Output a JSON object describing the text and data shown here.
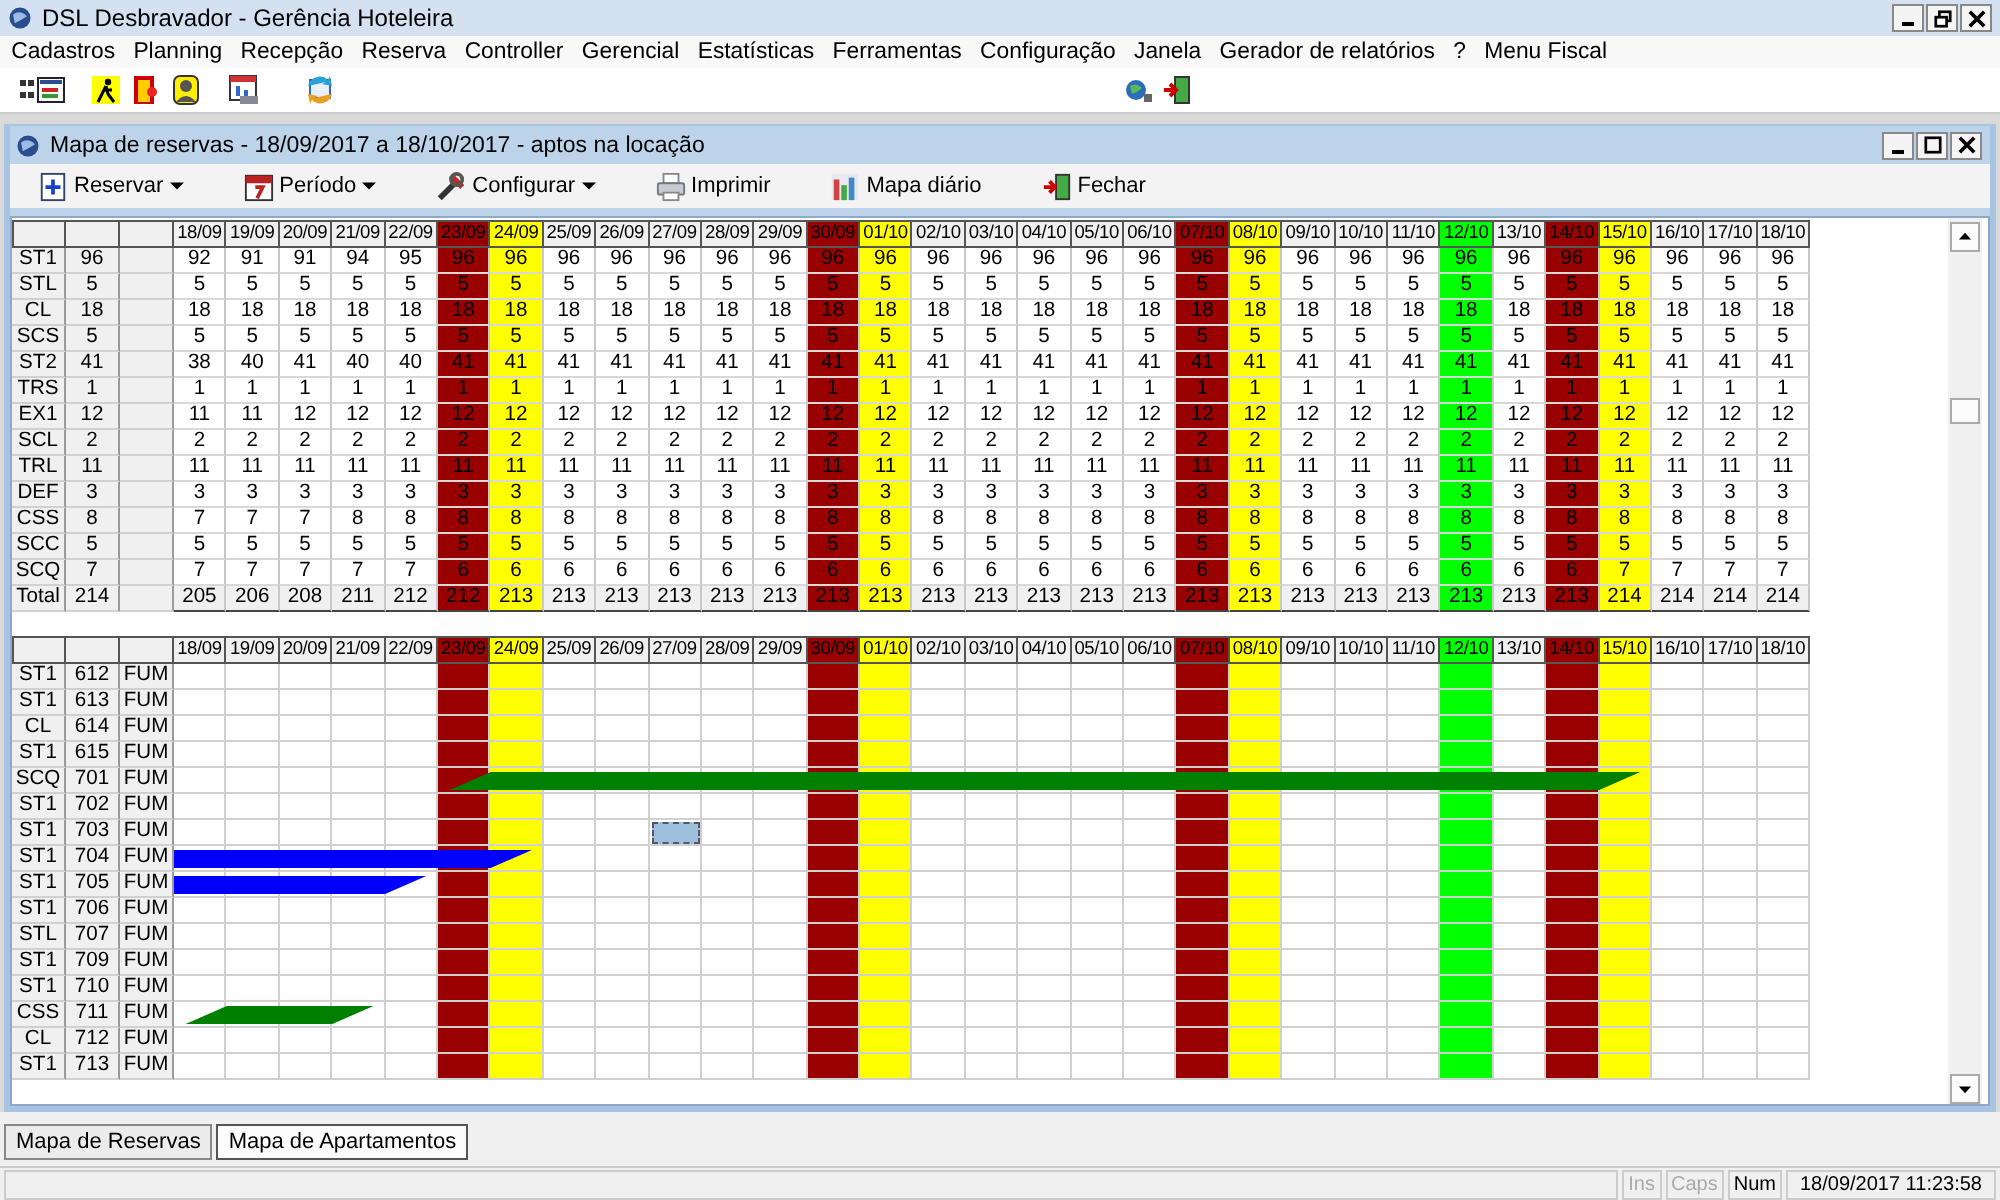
{
  "window": {
    "title": "DSL Desbravador - Gerência Hoteleira"
  },
  "menu": [
    "Cadastros",
    "Planning",
    "Recepção",
    "Reserva",
    "Controller",
    "Gerencial",
    "Estatísticas",
    "Ferramentas",
    "Configuração",
    "Janela",
    "Gerador de relatórios",
    "?",
    "Menu Fiscal"
  ],
  "child_window": {
    "title": "Mapa de reservas - 18/09/2017 a 18/10/2017 - aptos na locação"
  },
  "toolbar": [
    {
      "label": "Reservar",
      "kind": "new",
      "dropdown": true
    },
    {
      "label": "Período",
      "kind": "calendar",
      "dropdown": true
    },
    {
      "label": "Configurar",
      "kind": "tools",
      "dropdown": true
    },
    {
      "label": "Imprimir",
      "kind": "print",
      "dropdown": false
    },
    {
      "label": "Mapa diário",
      "kind": "chart",
      "dropdown": false
    },
    {
      "label": "Fechar",
      "kind": "exit",
      "dropdown": false
    }
  ],
  "availability": {
    "dates": [
      {
        "label": "18/09",
        "kind": "weekday"
      },
      {
        "label": "19/09",
        "kind": "weekday"
      },
      {
        "label": "20/09",
        "kind": "weekday"
      },
      {
        "label": "21/09",
        "kind": "weekday"
      },
      {
        "label": "22/09",
        "kind": "weekday"
      },
      {
        "label": "23/09",
        "kind": "saturday"
      },
      {
        "label": "24/09",
        "kind": "sunday"
      },
      {
        "label": "25/09",
        "kind": "weekday"
      },
      {
        "label": "26/09",
        "kind": "weekday"
      },
      {
        "label": "27/09",
        "kind": "weekday"
      },
      {
        "label": "28/09",
        "kind": "weekday"
      },
      {
        "label": "29/09",
        "kind": "weekday"
      },
      {
        "label": "30/09",
        "kind": "saturday"
      },
      {
        "label": "01/10",
        "kind": "sunday"
      },
      {
        "label": "02/10",
        "kind": "weekday"
      },
      {
        "label": "03/10",
        "kind": "weekday"
      },
      {
        "label": "04/10",
        "kind": "weekday"
      },
      {
        "label": "05/10",
        "kind": "weekday"
      },
      {
        "label": "06/10",
        "kind": "weekday"
      },
      {
        "label": "07/10",
        "kind": "saturday"
      },
      {
        "label": "08/10",
        "kind": "sunday"
      },
      {
        "label": "09/10",
        "kind": "weekday"
      },
      {
        "label": "10/10",
        "kind": "weekday"
      },
      {
        "label": "11/10",
        "kind": "weekday"
      },
      {
        "label": "12/10",
        "kind": "holiday"
      },
      {
        "label": "13/10",
        "kind": "weekday"
      },
      {
        "label": "14/10",
        "kind": "saturday"
      },
      {
        "label": "15/10",
        "kind": "sunday"
      },
      {
        "label": "16/10",
        "kind": "weekday"
      },
      {
        "label": "17/10",
        "kind": "weekday"
      },
      {
        "label": "18/10",
        "kind": "weekday"
      }
    ],
    "rows": [
      {
        "type": "ST1",
        "total": "96",
        "kind": "room_type",
        "values": [
          "92",
          "91",
          "91",
          "94",
          "95",
          "96",
          "96",
          "96",
          "96",
          "96",
          "96",
          "96",
          "96",
          "96",
          "96",
          "96",
          "96",
          "96",
          "96",
          "96",
          "96",
          "96",
          "96",
          "96",
          "96",
          "96",
          "96",
          "96",
          "96",
          "96",
          "96"
        ]
      },
      {
        "type": "STL",
        "total": "5",
        "kind": "room_type",
        "values": [
          "5",
          "5",
          "5",
          "5",
          "5",
          "5",
          "5",
          "5",
          "5",
          "5",
          "5",
          "5",
          "5",
          "5",
          "5",
          "5",
          "5",
          "5",
          "5",
          "5",
          "5",
          "5",
          "5",
          "5",
          "5",
          "5",
          "5",
          "5",
          "5",
          "5",
          "5"
        ]
      },
      {
        "type": "CL",
        "total": "18",
        "kind": "room_type",
        "values": [
          "18",
          "18",
          "18",
          "18",
          "18",
          "18",
          "18",
          "18",
          "18",
          "18",
          "18",
          "18",
          "18",
          "18",
          "18",
          "18",
          "18",
          "18",
          "18",
          "18",
          "18",
          "18",
          "18",
          "18",
          "18",
          "18",
          "18",
          "18",
          "18",
          "18",
          "18"
        ]
      },
      {
        "type": "SCS",
        "total": "5",
        "kind": "room_type",
        "values": [
          "5",
          "5",
          "5",
          "5",
          "5",
          "5",
          "5",
          "5",
          "5",
          "5",
          "5",
          "5",
          "5",
          "5",
          "5",
          "5",
          "5",
          "5",
          "5",
          "5",
          "5",
          "5",
          "5",
          "5",
          "5",
          "5",
          "5",
          "5",
          "5",
          "5",
          "5"
        ]
      },
      {
        "type": "ST2",
        "total": "41",
        "kind": "room_type",
        "values": [
          "38",
          "40",
          "41",
          "40",
          "40",
          "41",
          "41",
          "41",
          "41",
          "41",
          "41",
          "41",
          "41",
          "41",
          "41",
          "41",
          "41",
          "41",
          "41",
          "41",
          "41",
          "41",
          "41",
          "41",
          "41",
          "41",
          "41",
          "41",
          "41",
          "41",
          "41"
        ]
      },
      {
        "type": "TRS",
        "total": "1",
        "kind": "room_type",
        "values": [
          "1",
          "1",
          "1",
          "1",
          "1",
          "1",
          "1",
          "1",
          "1",
          "1",
          "1",
          "1",
          "1",
          "1",
          "1",
          "1",
          "1",
          "1",
          "1",
          "1",
          "1",
          "1",
          "1",
          "1",
          "1",
          "1",
          "1",
          "1",
          "1",
          "1",
          "1"
        ]
      },
      {
        "type": "EX1",
        "total": "12",
        "kind": "room_type",
        "values": [
          "11",
          "11",
          "12",
          "12",
          "12",
          "12",
          "12",
          "12",
          "12",
          "12",
          "12",
          "12",
          "12",
          "12",
          "12",
          "12",
          "12",
          "12",
          "12",
          "12",
          "12",
          "12",
          "12",
          "12",
          "12",
          "12",
          "12",
          "12",
          "12",
          "12",
          "12"
        ]
      },
      {
        "type": "SCL",
        "total": "2",
        "kind": "room_type",
        "values": [
          "2",
          "2",
          "2",
          "2",
          "2",
          "2",
          "2",
          "2",
          "2",
          "2",
          "2",
          "2",
          "2",
          "2",
          "2",
          "2",
          "2",
          "2",
          "2",
          "2",
          "2",
          "2",
          "2",
          "2",
          "2",
          "2",
          "2",
          "2",
          "2",
          "2",
          "2"
        ]
      },
      {
        "type": "TRL",
        "total": "11",
        "kind": "room_type",
        "values": [
          "11",
          "11",
          "11",
          "11",
          "11",
          "11",
          "11",
          "11",
          "11",
          "11",
          "11",
          "11",
          "11",
          "11",
          "11",
          "11",
          "11",
          "11",
          "11",
          "11",
          "11",
          "11",
          "11",
          "11",
          "11",
          "11",
          "11",
          "11",
          "11",
          "11",
          "11"
        ]
      },
      {
        "type": "DEF",
        "total": "3",
        "kind": "room_type",
        "values": [
          "3",
          "3",
          "3",
          "3",
          "3",
          "3",
          "3",
          "3",
          "3",
          "3",
          "3",
          "3",
          "3",
          "3",
          "3",
          "3",
          "3",
          "3",
          "3",
          "3",
          "3",
          "3",
          "3",
          "3",
          "3",
          "3",
          "3",
          "3",
          "3",
          "3",
          "3"
        ]
      },
      {
        "type": "CSS",
        "total": "8",
        "kind": "room_type",
        "values": [
          "7",
          "7",
          "7",
          "8",
          "8",
          "8",
          "8",
          "8",
          "8",
          "8",
          "8",
          "8",
          "8",
          "8",
          "8",
          "8",
          "8",
          "8",
          "8",
          "8",
          "8",
          "8",
          "8",
          "8",
          "8",
          "8",
          "8",
          "8",
          "8",
          "8",
          "8"
        ]
      },
      {
        "type": "SCC",
        "total": "5",
        "kind": "room_type",
        "values": [
          "5",
          "5",
          "5",
          "5",
          "5",
          "5",
          "5",
          "5",
          "5",
          "5",
          "5",
          "5",
          "5",
          "5",
          "5",
          "5",
          "5",
          "5",
          "5",
          "5",
          "5",
          "5",
          "5",
          "5",
          "5",
          "5",
          "5",
          "5",
          "5",
          "5",
          "5"
        ]
      },
      {
        "type": "SCQ",
        "total": "7",
        "kind": "room_type",
        "values": [
          "7",
          "7",
          "7",
          "7",
          "7",
          "6",
          "6",
          "6",
          "6",
          "6",
          "6",
          "6",
          "6",
          "6",
          "6",
          "6",
          "6",
          "6",
          "6",
          "6",
          "6",
          "6",
          "6",
          "6",
          "6",
          "6",
          "6",
          "7",
          "7",
          "7",
          "7"
        ]
      },
      {
        "type": "Total",
        "total": "214",
        "kind": "total",
        "values": [
          "205",
          "206",
          "208",
          "211",
          "212",
          "212",
          "213",
          "213",
          "213",
          "213",
          "213",
          "213",
          "213",
          "213",
          "213",
          "213",
          "213",
          "213",
          "213",
          "213",
          "213",
          "213",
          "213",
          "213",
          "213",
          "213",
          "213",
          "214",
          "214",
          "214",
          "214"
        ]
      }
    ]
  },
  "rooms": {
    "dates": [
      {
        "label": "18/09",
        "kind": "weekday"
      },
      {
        "label": "19/09",
        "kind": "weekday"
      },
      {
        "label": "20/09",
        "kind": "weekday"
      },
      {
        "label": "21/09",
        "kind": "weekday"
      },
      {
        "label": "22/09",
        "kind": "weekday"
      },
      {
        "label": "23/09",
        "kind": "saturday"
      },
      {
        "label": "24/09",
        "kind": "sunday"
      },
      {
        "label": "25/09",
        "kind": "weekday"
      },
      {
        "label": "26/09",
        "kind": "weekday"
      },
      {
        "label": "27/09",
        "kind": "weekday"
      },
      {
        "label": "28/09",
        "kind": "weekday"
      },
      {
        "label": "29/09",
        "kind": "weekday"
      },
      {
        "label": "30/09",
        "kind": "saturday"
      },
      {
        "label": "01/10",
        "kind": "sunday"
      },
      {
        "label": "02/10",
        "kind": "weekday"
      },
      {
        "label": "03/10",
        "kind": "weekday"
      },
      {
        "label": "04/10",
        "kind": "weekday"
      },
      {
        "label": "05/10",
        "kind": "weekday"
      },
      {
        "label": "06/10",
        "kind": "weekday"
      },
      {
        "label": "07/10",
        "kind": "saturday"
      },
      {
        "label": "08/10",
        "kind": "sunday"
      },
      {
        "label": "09/10",
        "kind": "weekday"
      },
      {
        "label": "10/10",
        "kind": "weekday"
      },
      {
        "label": "11/10",
        "kind": "weekday"
      },
      {
        "label": "12/10",
        "kind": "holiday"
      },
      {
        "label": "13/10",
        "kind": "weekday"
      },
      {
        "label": "14/10",
        "kind": "saturday"
      },
      {
        "label": "15/10",
        "kind": "sunday"
      },
      {
        "label": "16/10",
        "kind": "weekday"
      },
      {
        "label": "17/10",
        "kind": "weekday"
      },
      {
        "label": "18/10",
        "kind": "weekday"
      }
    ],
    "rows": [
      {
        "type": "ST1",
        "number": "612",
        "status": "FUM"
      },
      {
        "type": "ST1",
        "number": "613",
        "status": "FUM"
      },
      {
        "type": "CL",
        "number": "614",
        "status": "FUM"
      },
      {
        "type": "ST1",
        "number": "615",
        "status": "FUM"
      },
      {
        "type": "SCQ",
        "number": "701",
        "status": "FUM",
        "color": "#008000",
        "cells": [
          {
            "kind": "free"
          },
          {
            "kind": "free"
          },
          {
            "kind": "free"
          },
          {
            "kind": "free"
          },
          {
            "kind": "free"
          },
          {
            "kind": "start"
          },
          {
            "kind": "body"
          },
          {
            "kind": "body"
          },
          {
            "kind": "body"
          },
          {
            "kind": "body"
          },
          {
            "kind": "body"
          },
          {
            "kind": "body"
          },
          {
            "kind": "body"
          },
          {
            "kind": "body"
          },
          {
            "kind": "body"
          },
          {
            "kind": "body"
          },
          {
            "kind": "body"
          },
          {
            "kind": "body"
          },
          {
            "kind": "body"
          },
          {
            "kind": "body"
          },
          {
            "kind": "body"
          },
          {
            "kind": "body"
          },
          {
            "kind": "body"
          },
          {
            "kind": "body"
          },
          {
            "kind": "body"
          },
          {
            "kind": "body"
          },
          {
            "kind": "body"
          },
          {
            "kind": "end"
          },
          {
            "kind": "free"
          },
          {
            "kind": "free"
          },
          {
            "kind": "free"
          }
        ]
      },
      {
        "type": "ST1",
        "number": "702",
        "status": "FUM"
      },
      {
        "type": "ST1",
        "number": "703",
        "status": "FUM",
        "cells": [
          {
            "kind": "free"
          },
          {
            "kind": "free"
          },
          {
            "kind": "free"
          },
          {
            "kind": "free"
          },
          {
            "kind": "free"
          },
          {
            "kind": "free"
          },
          {
            "kind": "free"
          },
          {
            "kind": "free"
          },
          {
            "kind": "free"
          },
          {
            "kind": "marked"
          },
          {
            "kind": "free"
          },
          {
            "kind": "free"
          },
          {
            "kind": "free"
          },
          {
            "kind": "free"
          },
          {
            "kind": "free"
          },
          {
            "kind": "free"
          },
          {
            "kind": "free"
          },
          {
            "kind": "free"
          },
          {
            "kind": "free"
          },
          {
            "kind": "free"
          },
          {
            "kind": "free"
          },
          {
            "kind": "free"
          },
          {
            "kind": "free"
          },
          {
            "kind": "free"
          },
          {
            "kind": "free"
          },
          {
            "kind": "free"
          },
          {
            "kind": "free"
          },
          {
            "kind": "free"
          },
          {
            "kind": "free"
          },
          {
            "kind": "free"
          },
          {
            "kind": "free"
          }
        ]
      },
      {
        "type": "ST1",
        "number": "704",
        "status": "FUM",
        "color": "#0000ff",
        "cells": [
          {
            "kind": "body"
          },
          {
            "kind": "body"
          },
          {
            "kind": "body"
          },
          {
            "kind": "body"
          },
          {
            "kind": "body"
          },
          {
            "kind": "body"
          },
          {
            "kind": "end"
          },
          {
            "kind": "free"
          },
          {
            "kind": "free"
          },
          {
            "kind": "free"
          },
          {
            "kind": "free"
          },
          {
            "kind": "free"
          },
          {
            "kind": "free"
          },
          {
            "kind": "free"
          },
          {
            "kind": "free"
          },
          {
            "kind": "free"
          },
          {
            "kind": "free"
          },
          {
            "kind": "free"
          },
          {
            "kind": "free"
          },
          {
            "kind": "free"
          },
          {
            "kind": "free"
          },
          {
            "kind": "free"
          },
          {
            "kind": "free"
          },
          {
            "kind": "free"
          },
          {
            "kind": "free"
          },
          {
            "kind": "free"
          },
          {
            "kind": "free"
          },
          {
            "kind": "free"
          },
          {
            "kind": "free"
          },
          {
            "kind": "free"
          },
          {
            "kind": "free"
          }
        ]
      },
      {
        "type": "ST1",
        "number": "705",
        "status": "FUM",
        "color": "#0000ff",
        "cells": [
          {
            "kind": "body"
          },
          {
            "kind": "body"
          },
          {
            "kind": "body"
          },
          {
            "kind": "body"
          },
          {
            "kind": "end"
          },
          {
            "kind": "free"
          },
          {
            "kind": "free"
          },
          {
            "kind": "free"
          },
          {
            "kind": "free"
          },
          {
            "kind": "free"
          },
          {
            "kind": "free"
          },
          {
            "kind": "free"
          },
          {
            "kind": "free"
          },
          {
            "kind": "free"
          },
          {
            "kind": "free"
          },
          {
            "kind": "free"
          },
          {
            "kind": "free"
          },
          {
            "kind": "free"
          },
          {
            "kind": "free"
          },
          {
            "kind": "free"
          },
          {
            "kind": "free"
          },
          {
            "kind": "free"
          },
          {
            "kind": "free"
          },
          {
            "kind": "free"
          },
          {
            "kind": "free"
          },
          {
            "kind": "free"
          },
          {
            "kind": "free"
          },
          {
            "kind": "free"
          },
          {
            "kind": "free"
          },
          {
            "kind": "free"
          },
          {
            "kind": "free"
          }
        ]
      },
      {
        "type": "ST1",
        "number": "706",
        "status": "FUM"
      },
      {
        "type": "STL",
        "number": "707",
        "status": "FUM"
      },
      {
        "type": "ST1",
        "number": "709",
        "status": "FUM"
      },
      {
        "type": "ST1",
        "number": "710",
        "status": "FUM"
      },
      {
        "type": "CSS",
        "number": "711",
        "status": "FUM",
        "color": "#008000",
        "cells": [
          {
            "kind": "start"
          },
          {
            "kind": "body"
          },
          {
            "kind": "body"
          },
          {
            "kind": "end"
          },
          {
            "kind": "free"
          },
          {
            "kind": "free"
          },
          {
            "kind": "free"
          },
          {
            "kind": "free"
          },
          {
            "kind": "free"
          },
          {
            "kind": "free"
          },
          {
            "kind": "free"
          },
          {
            "kind": "free"
          },
          {
            "kind": "free"
          },
          {
            "kind": "free"
          },
          {
            "kind": "free"
          },
          {
            "kind": "free"
          },
          {
            "kind": "free"
          },
          {
            "kind": "free"
          },
          {
            "kind": "free"
          },
          {
            "kind": "free"
          },
          {
            "kind": "free"
          },
          {
            "kind": "free"
          },
          {
            "kind": "free"
          },
          {
            "kind": "free"
          },
          {
            "kind": "free"
          },
          {
            "kind": "free"
          },
          {
            "kind": "free"
          },
          {
            "kind": "free"
          },
          {
            "kind": "free"
          },
          {
            "kind": "free"
          },
          {
            "kind": "free"
          }
        ]
      },
      {
        "type": "CL",
        "number": "712",
        "status": "FUM"
      },
      {
        "type": "ST1",
        "number": "713",
        "status": "FUM"
      }
    ]
  },
  "tabs": [
    {
      "label": "Mapa de Reservas",
      "selected": false
    },
    {
      "label": "Mapa de Apartamentos",
      "selected": true
    }
  ],
  "status_bar": {
    "indicators": [
      {
        "label": "Ins",
        "on": false
      },
      {
        "label": "Caps",
        "on": false
      },
      {
        "label": "Num",
        "on": true
      }
    ],
    "datetime": "18/09/2017 11:23:58"
  }
}
